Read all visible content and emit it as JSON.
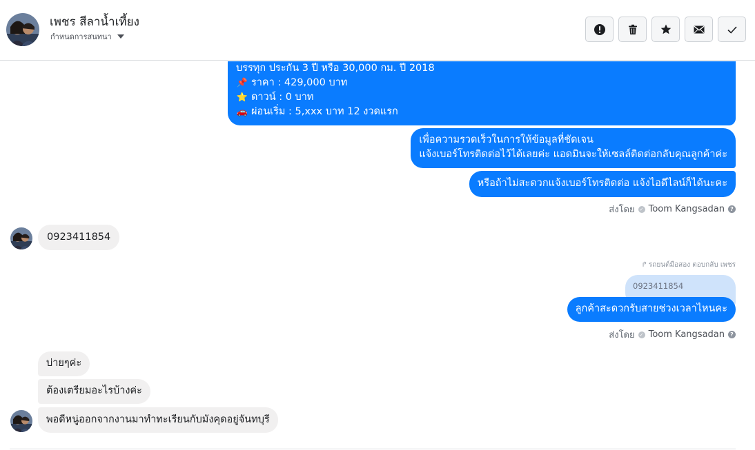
{
  "header": {
    "contact_name": "เพชร สีลาน้ำเที้ยง",
    "assign_label": "กำหนดการสนทนา"
  },
  "toolbar": {
    "buttons": [
      {
        "name": "spam-button",
        "icon": "exclamation-icon"
      },
      {
        "name": "delete-button",
        "icon": "trash-icon"
      },
      {
        "name": "star-button",
        "icon": "star-icon"
      },
      {
        "name": "mark-unread-button",
        "icon": "envelope-icon"
      },
      {
        "name": "done-button",
        "icon": "checkmark-icon"
      }
    ]
  },
  "messages": {
    "car_info": {
      "line1": "บรรทุก ประกัน 3 ปี หรือ 30,000 กม. ปี 2018",
      "line2": "ราคา : 429,000 บาท",
      "line3": "ดาวน์ : 0 บาท",
      "line4": "ผ่อนเริ่ม : 5,xxx บาท 12 งวดแรก",
      "emoji2": "📌",
      "emoji3": "⭐",
      "emoji4": "🚗"
    },
    "request_phone": {
      "line1": "เพื่อความรวดเร็วในการให้ข้อมูลที่ชัดเจน",
      "line2": "แจ้งเบอร์โทรติดต่อไว้ได้เลยค่ะ แอดมินจะให้เซลล์ติดต่อกลับคุณลูกค้าค่ะ"
    },
    "alt_line": "หรือถ้าไม่สะดวกแจ้งเบอร์โทรติดต่อ แจ้งไอดีไลน์ก็ได้นะคะ",
    "sent_by_label": "ส่งโดย",
    "sent_by_name": "Toom Kangsadan",
    "customer_phone": "0923411854",
    "reply_meta": "รถยนต์มือสอง ตอบกลับ เพชร",
    "quoted_text": "0923411854",
    "ask_time": "ลูกค้าสะดวกรับสายช่วงเวลาไหนคะ",
    "customer_replies": [
      "บ่ายๆค่ะ",
      "ต้องเตรียมอะไรบ้างค่ะ",
      "พอดีหนู่ออกจากงานมาทำทะเรียนกับมังคุดอยู่จันทบุรี"
    ]
  },
  "colors": {
    "outgoing": "#0a7cff",
    "incoming": "#f1f0f0",
    "quoted": "#cfe3fb"
  }
}
